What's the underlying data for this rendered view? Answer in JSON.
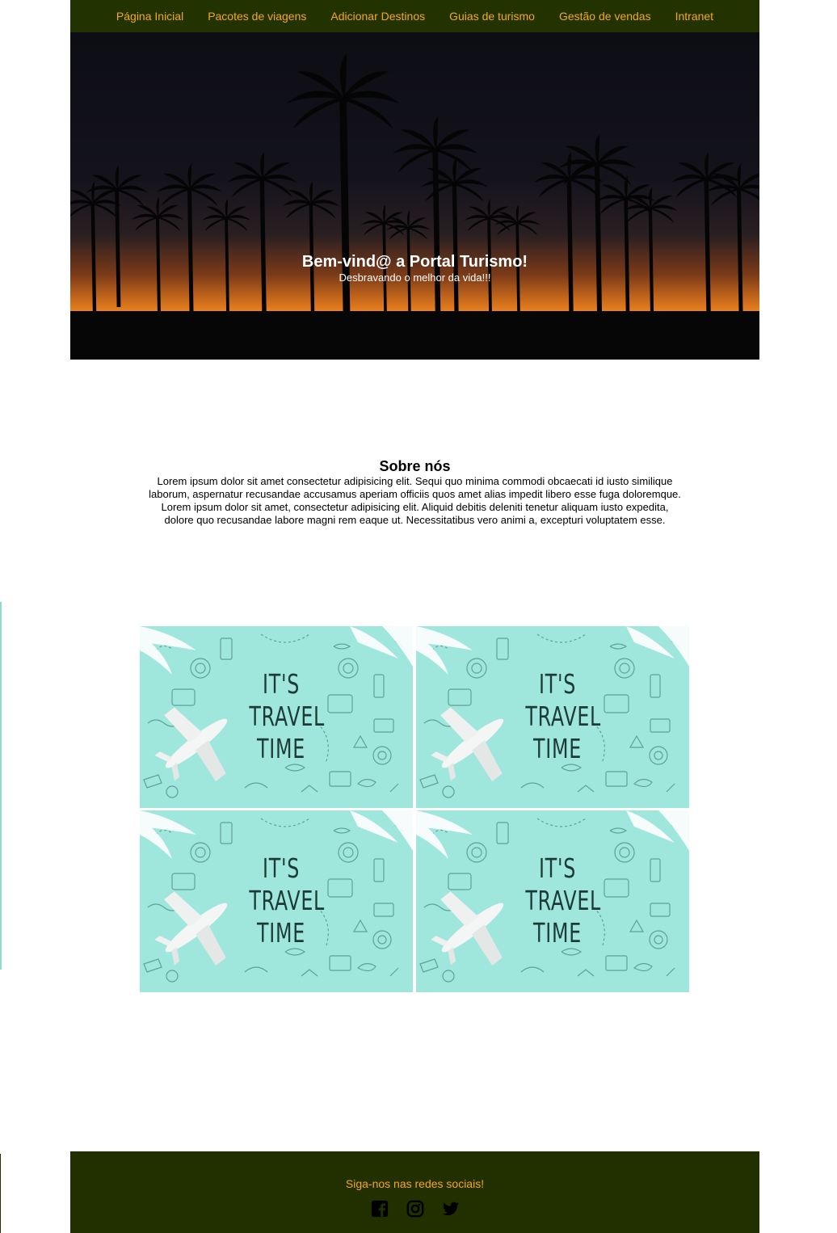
{
  "nav": {
    "items": [
      {
        "label": "Página Inicial"
      },
      {
        "label": "Pacotes de viagens"
      },
      {
        "label": "Adicionar Destinos"
      },
      {
        "label": "Guias de turismo"
      },
      {
        "label": "Gestão de vendas"
      },
      {
        "label": "Intranet"
      }
    ]
  },
  "hero": {
    "title": "Bem-vind@ a Portal Turismo!",
    "subtitle": "Desbravando o melhor da vida!!!"
  },
  "about": {
    "title": "Sobre nós",
    "text": "Lorem ipsum dolor sit amet consectetur adipisicing elit. Sequi quo minima commodi obcaecati id iusto similique laborum, aspernatur recusandae accusamus aperiam officiis quos amet alias impedit libero esse fuga doloremque. Lorem ipsum dolor sit amet, consectetur adipisicing elit. Aliquid debitis deleniti tenetur aliquam iusto expedita, dolore quo recusandae labore magni rem eaque ut. Necessitatibus vero animi a, excepturi voluptatem esse."
  },
  "gallery": {
    "tiles": [
      {
        "caption_lines": [
          "IT'S",
          "TRAVEL",
          "TIME"
        ]
      },
      {
        "caption_lines": [
          "IT'S",
          "TRAVEL",
          "TIME"
        ]
      },
      {
        "caption_lines": [
          "IT'S",
          "TRAVEL",
          "TIME"
        ]
      },
      {
        "caption_lines": [
          "IT'S",
          "TRAVEL",
          "TIME"
        ]
      }
    ]
  },
  "footer": {
    "text": "Siga-nos nas redes sociais!",
    "social": [
      {
        "icon": "facebook-icon"
      },
      {
        "icon": "instagram-icon"
      },
      {
        "icon": "twitter-icon"
      }
    ]
  },
  "colors": {
    "nav_bg": "#233300",
    "accent": "#f5a623",
    "tile_bg": "#9fe6dc"
  }
}
